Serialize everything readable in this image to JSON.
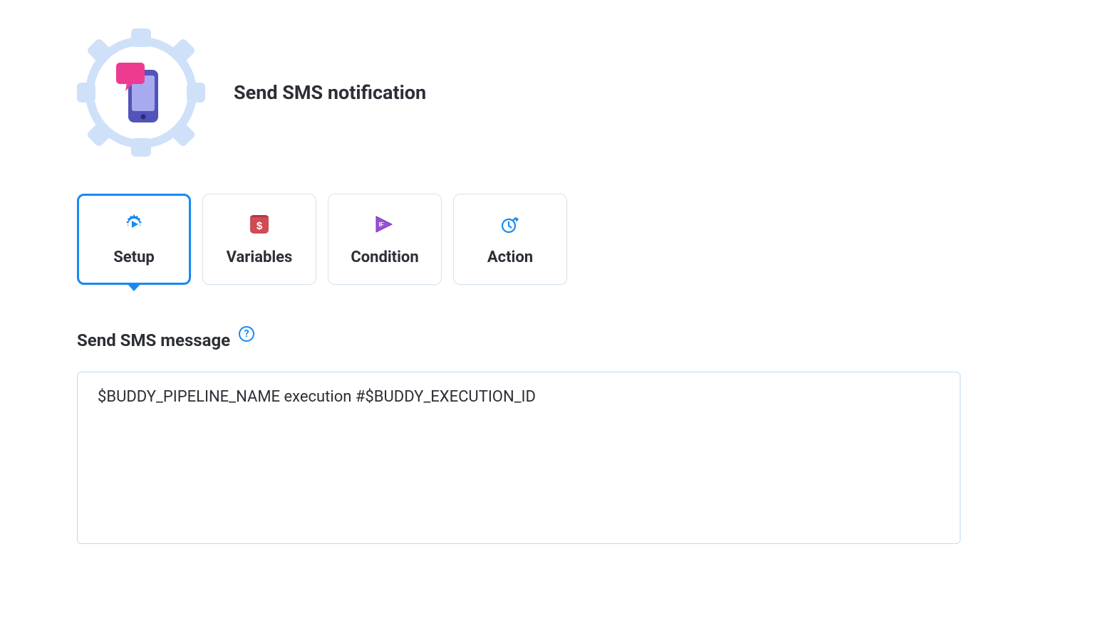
{
  "header": {
    "title": "Send SMS notification"
  },
  "tabs": [
    {
      "label": "Setup"
    },
    {
      "label": "Variables"
    },
    {
      "label": "Condition"
    },
    {
      "label": "Action"
    }
  ],
  "section": {
    "heading": "Send SMS message",
    "help": "?"
  },
  "message": {
    "value": "$BUDDY_PIPELINE_NAME execution #$BUDDY_EXECUTION_ID"
  }
}
